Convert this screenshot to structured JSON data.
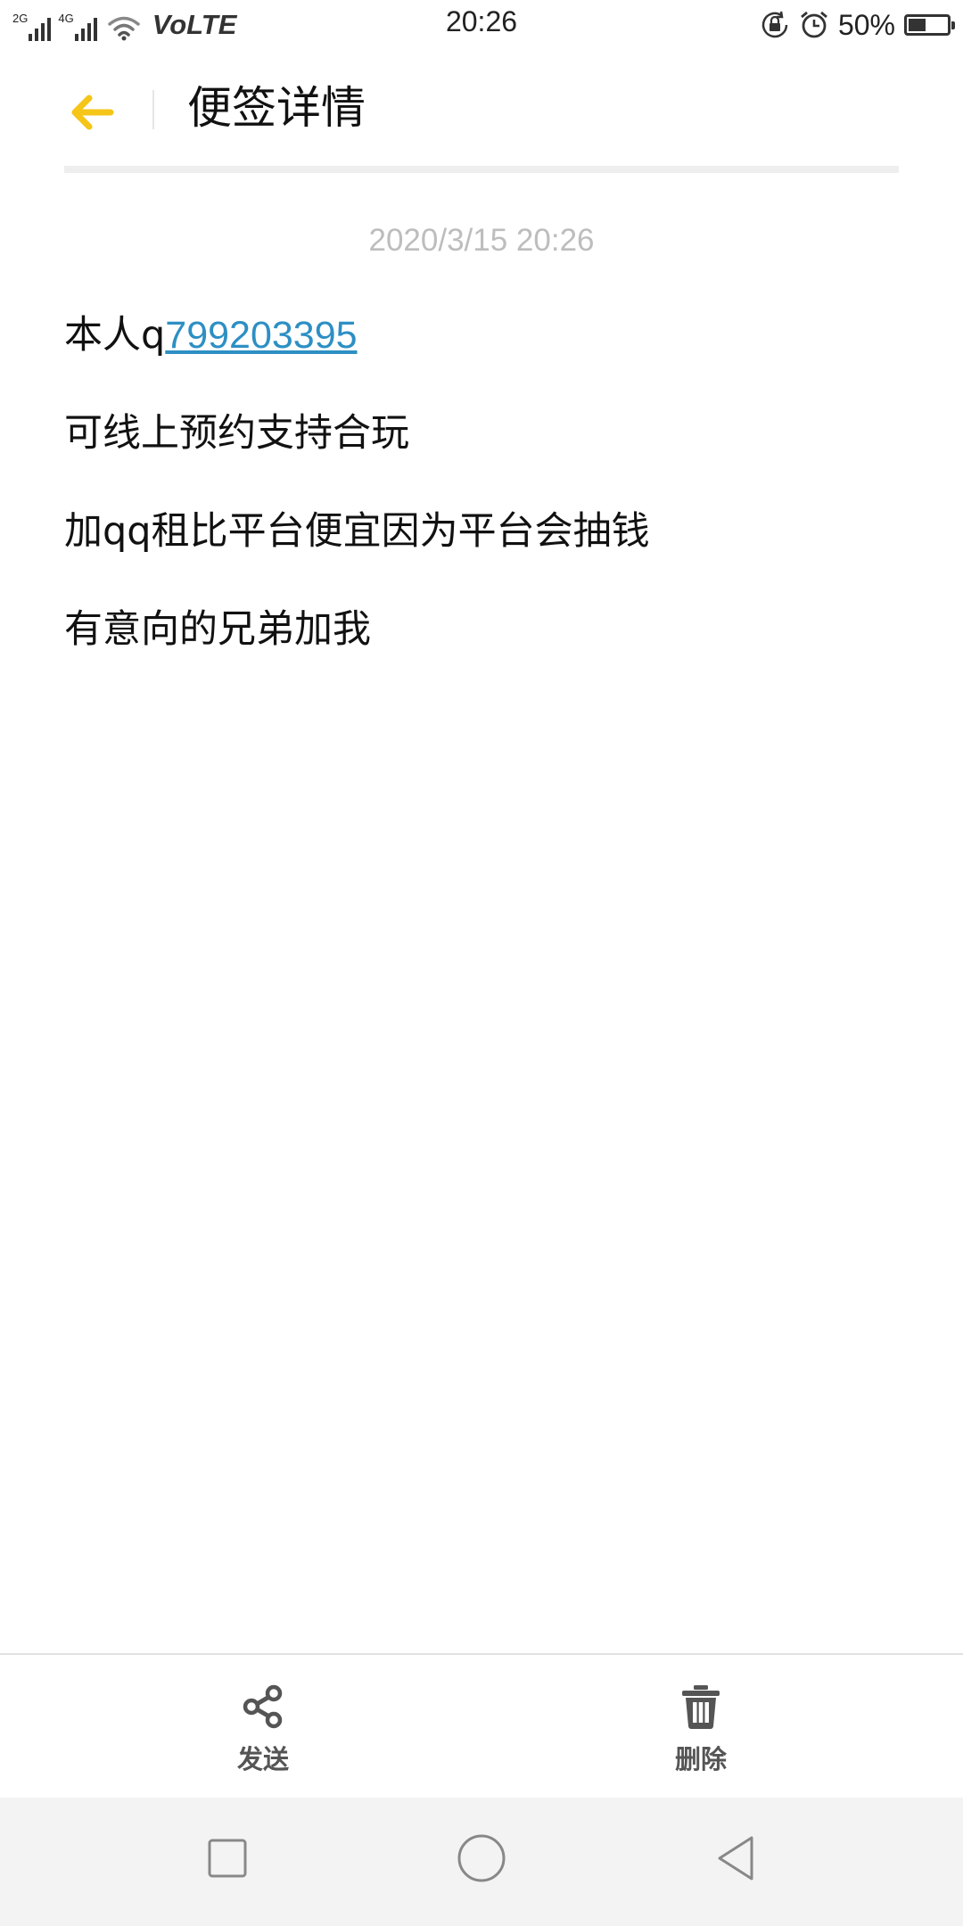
{
  "status_bar": {
    "network_1": "2G",
    "network_2": "4G",
    "volte": "VoLTE",
    "time": "20:26",
    "battery_percent": "50%",
    "battery_level": 0.5
  },
  "header": {
    "title": "便签详情",
    "accent_color": "#F5C518"
  },
  "note": {
    "timestamp": "2020/3/15 20:26",
    "line1_prefix": "本人q",
    "line1_link": "799203395",
    "lines": [
      "可线上预约支持合玩",
      "加qq租比平台便宜因为平台会抽钱",
      "有意向的兄弟加我"
    ],
    "link_color": "#2D8FC4"
  },
  "actions": {
    "send_label": "发送",
    "delete_label": "删除"
  },
  "icons": {
    "back": "arrow-left-icon",
    "send": "share-icon",
    "delete": "trash-icon",
    "recents": "square-icon",
    "home": "circle-icon",
    "nav_back": "triangle-back-icon"
  }
}
